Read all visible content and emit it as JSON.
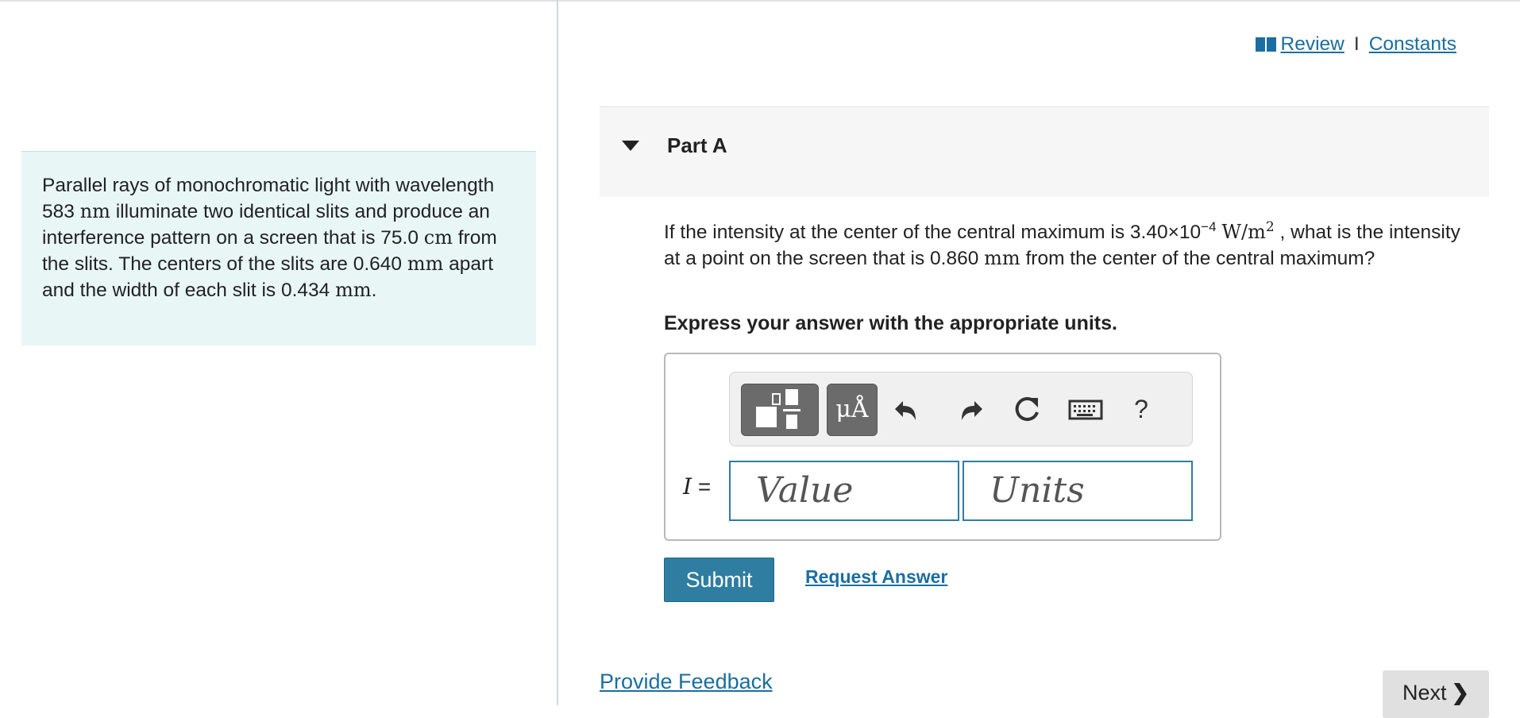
{
  "top_links": {
    "review": "Review",
    "separator": "I",
    "constants": "Constants"
  },
  "intro": {
    "t1": "Parallel rays of monochromatic light with wavelength 583 ",
    "u1": "nm",
    "t2": " illuminate two identical slits and produce an interference pattern on a screen that is 75.0 ",
    "u2": "cm",
    "t3": " from the slits. The centers of the slits are 0.640 ",
    "u3": "mm",
    "t4": " apart and the width of each slit is 0.434 ",
    "u4": "mm",
    "t5": "."
  },
  "part": {
    "title": "Part A"
  },
  "question": {
    "q1": "If the intensity at the center of the central maximum is 3.40×10",
    "exp": "−4",
    "unit_w": "W/m",
    "unit_exp": "2",
    "q2": " , what is the intensity at a point on the screen that is 0.860 ",
    "unit_mm": "mm",
    "q3": " from the center of the central maximum?"
  },
  "instructions": "Express your answer with the appropriate units.",
  "toolbar": {
    "units_label": "μÅ",
    "help_label": "?"
  },
  "answer": {
    "variable": "I",
    "equals": "=",
    "value_placeholder": "Value",
    "units_placeholder": "Units"
  },
  "buttons": {
    "submit": "Submit",
    "request_answer": "Request Answer",
    "provide_feedback": "Provide Feedback",
    "next": "Next"
  }
}
